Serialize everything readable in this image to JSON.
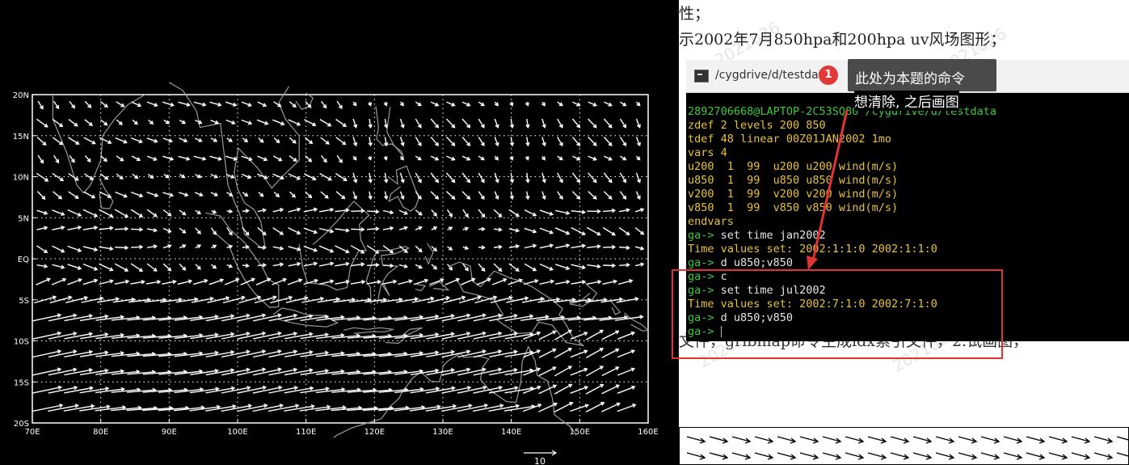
{
  "grads": {
    "y_labels": [
      "20N",
      "15N",
      "10N",
      "5N",
      "EQ",
      "5S",
      "10S",
      "15S",
      "20S"
    ],
    "x_labels": [
      "70E",
      "80E",
      "90E",
      "100E",
      "110E",
      "120E",
      "130E",
      "140E",
      "150E",
      "160E"
    ],
    "scale_label": "10",
    "lon_range": [
      70,
      160
    ],
    "lat_range": [
      -20,
      20
    ],
    "plot_background": "#000000",
    "vector_color": "#ffffff",
    "coast_color": "#9a9a9a"
  },
  "doc": {
    "line1": "性；",
    "line2": "示2002年7月850hpa和200hpa uv风场图形；",
    "line3": "文件，gribmap命令生成idx索引文件，2.试画图，",
    "watermark": "2021026"
  },
  "terminal": {
    "title": "/cygdrive/d/testdata",
    "lines": [
      {
        "text": "2892706668@LAPTOP-2C53SQ80 /cygdrive/d/testdata",
        "color": "green"
      },
      {
        "text": "zdef 2 levels 200 850",
        "color": "yellow"
      },
      {
        "text": "tdef 48 linear 00Z01JAN2002 1mo",
        "color": "yellow"
      },
      {
        "text": "vars 4",
        "color": "yellow"
      },
      {
        "text": "u200  1  99  u200 u200 wind(m/s)",
        "color": "yellow"
      },
      {
        "text": "u850  1  99  u850 u850 wind(m/s)",
        "color": "yellow"
      },
      {
        "text": "v200  1  99  v200 v200 wind(m/s)",
        "color": "yellow"
      },
      {
        "text": "v850  1  99  v850 v850 wind(m/s)",
        "color": "yellow"
      },
      {
        "text": "endvars",
        "color": "yellow"
      },
      {
        "prompt": "ga->",
        "text": " set time jan2002"
      },
      {
        "text": "Time values set: 2002:1:1:0 2002:1:1:0",
        "color": "yellow"
      },
      {
        "prompt": "ga->",
        "text": " d u850;v850"
      },
      {
        "prompt": "ga->",
        "text": " c"
      },
      {
        "prompt": "ga->",
        "text": " set time jul2002"
      },
      {
        "text": "Time values set: 2002:7:1:0 2002:7:1:0",
        "color": "yellow"
      },
      {
        "prompt": "ga->",
        "text": " d u850;v850"
      },
      {
        "prompt": "ga->",
        "text": " ",
        "cursor": true
      }
    ]
  },
  "annotation": {
    "badge_number": "1",
    "tooltip_line1": "此处为本题的命令",
    "tooltip_line2": "想清除, 之后画图",
    "color": "#e03333"
  }
}
